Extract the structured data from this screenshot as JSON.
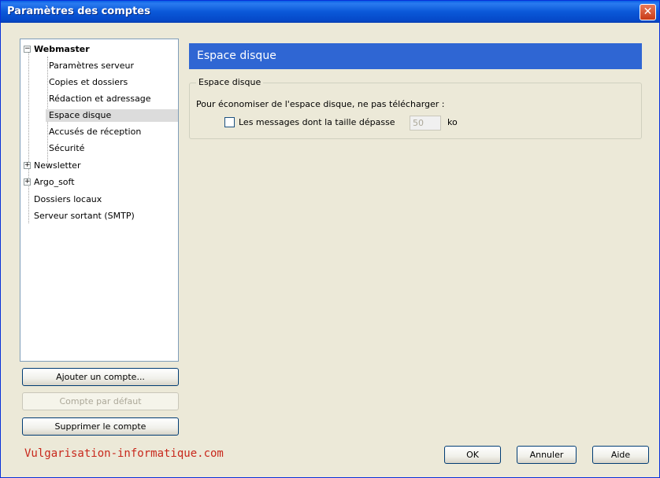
{
  "window": {
    "title": "Paramètres des comptes",
    "close_glyph": "✕"
  },
  "tree": {
    "accounts": [
      {
        "label": "Webmaster",
        "expander": "−",
        "children": [
          "Paramètres serveur",
          "Copies et dossiers",
          "Rédaction et adressage",
          "Espace disque",
          "Accusés de réception",
          "Sécurité"
        ]
      },
      {
        "label": "Newsletter",
        "expander": "+"
      },
      {
        "label": "Argo_soft",
        "expander": "+"
      },
      {
        "label": "Dossiers locaux"
      },
      {
        "label": "Serveur sortant (SMTP)"
      }
    ],
    "selected": "Espace disque"
  },
  "left_buttons": {
    "add": "Ajouter un compte...",
    "default": "Compte par défaut",
    "delete": "Supprimer le compte"
  },
  "panel": {
    "header": "Espace disque",
    "group_title": "Espace disque",
    "description": "Pour économiser de l'espace disque, ne pas télécharger :",
    "checkbox_label": "Les messages dont la taille dépasse",
    "checkbox_checked": false,
    "size_value": "50",
    "size_unit": "ko"
  },
  "footer": {
    "watermark": "Vulgarisation-informatique.com",
    "ok": "OK",
    "cancel": "Annuler",
    "help": "Aide"
  }
}
